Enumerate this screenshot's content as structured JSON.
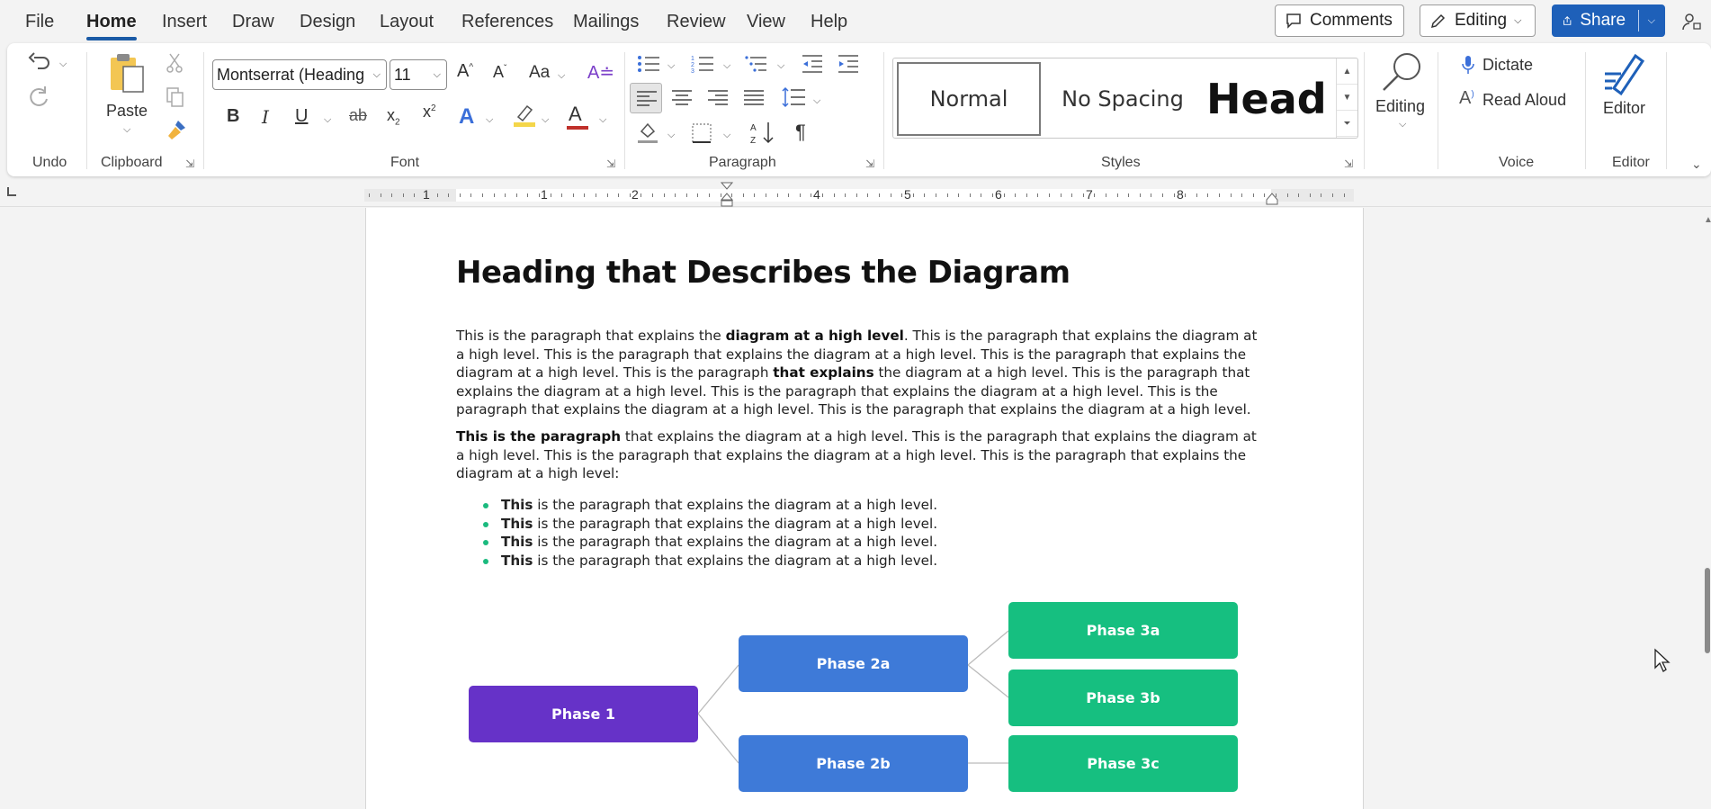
{
  "menu": {
    "items": [
      "File",
      "Home",
      "Insert",
      "Draw",
      "Design",
      "Layout",
      "References",
      "Mailings",
      "Review",
      "View",
      "Help"
    ],
    "active": "Home",
    "comments_label": "Comments",
    "editing_label": "Editing",
    "share_label": "Share"
  },
  "ribbon": {
    "groups": {
      "undo": "Undo",
      "clipboard": "Clipboard",
      "font": "Font",
      "paragraph": "Paragraph",
      "styles": "Styles",
      "voice": "Voice",
      "editor": "Editor"
    },
    "paste_label": "Paste",
    "font_name": "Montserrat (Heading",
    "font_size": "11",
    "change_case_label": "Aa",
    "styles": [
      "Normal",
      "No Spacing",
      "Headi"
    ],
    "editing_label": "Editing",
    "dictate_label": "Dictate",
    "read_aloud_label": "Read Aloud",
    "editor_label": "Editor"
  },
  "ruler": {
    "numbers": [
      "1",
      "1",
      "2",
      "3",
      "4",
      "5",
      "6",
      "7",
      "8"
    ]
  },
  "document": {
    "title": "Heading that Describes the Diagram",
    "para1": [
      {
        "t": "This is the paragraph that explains the ",
        "b": false
      },
      {
        "t": "diagram at a high level",
        "b": true
      },
      {
        "t": ". This is the paragraph that explains the diagram at a high level. This is the paragraph that explains the diagram at a high level. This is the paragraph that explains the diagram at a high level. This is the paragraph ",
        "b": false
      },
      {
        "t": "that explains",
        "b": true
      },
      {
        "t": " the diagram at a high level. This is the paragraph that explains the diagram at a high level. This is the paragraph that explains the diagram at a high level. This is the paragraph that explains the diagram at a high level. This is the paragraph that explains the diagram at a high level.",
        "b": false
      }
    ],
    "para2": [
      {
        "t": "This is the paragraph",
        "b": true
      },
      {
        "t": " that explains the diagram at a high level. This is the paragraph that explains the diagram at a high level. This is the paragraph that explains the diagram at a high level. This is the paragraph that explains the diagram at a high level:",
        "b": false
      }
    ],
    "bullets": [
      {
        "bold": "This",
        "rest": " is the paragraph that explains the diagram at a high level."
      },
      {
        "bold": "This",
        "rest": " is the paragraph that explains the diagram at a high level."
      },
      {
        "bold": "This",
        "rest": " is the paragraph that explains the diagram at a high level."
      },
      {
        "bold": "This",
        "rest": " is the paragraph that explains the diagram at a high level."
      }
    ],
    "diagram": {
      "phase1": "Phase 1",
      "phase2a": "Phase 2a",
      "phase2b": "Phase 2b",
      "phase3a": "Phase 3a",
      "phase3b": "Phase 3b",
      "phase3c": "Phase 3c"
    }
  },
  "colors": {
    "accent": "#1e60b9",
    "phase_purple": "#6632c8",
    "phase_blue": "#3e7ad8",
    "phase_green": "#16bf80",
    "bullet": "#1bba7e"
  }
}
